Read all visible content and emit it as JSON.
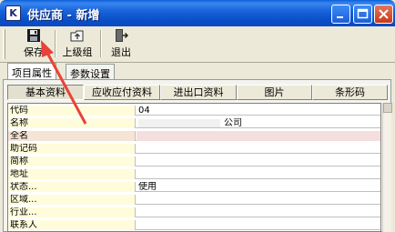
{
  "window": {
    "title": "供应商 - 新增",
    "app_icon_glyph": "K"
  },
  "toolbar": {
    "save_label": "保存",
    "up_level_label": "上级组",
    "exit_label": "退出"
  },
  "tabs": [
    {
      "label": "项目属性",
      "active": true
    },
    {
      "label": "参数设置",
      "active": false
    }
  ],
  "sub_tabs": [
    {
      "label": "基本资料",
      "active": true
    },
    {
      "label": "应收应付资料",
      "active": false
    },
    {
      "label": "进出口资料",
      "active": false
    },
    {
      "label": "图片",
      "active": false
    },
    {
      "label": "条形码",
      "active": false
    }
  ],
  "grid": {
    "rows": [
      {
        "label": "代码",
        "value": "04"
      },
      {
        "label": "名称",
        "value": "公司"
      },
      {
        "label": "全名",
        "value": ""
      },
      {
        "label": "助记码",
        "value": ""
      },
      {
        "label": "简称",
        "value": ""
      },
      {
        "label": "地址",
        "value": ""
      },
      {
        "label": "状态...",
        "value": "使用"
      },
      {
        "label": "区域...",
        "value": ""
      },
      {
        "label": "行业...",
        "value": ""
      },
      {
        "label": "联系人",
        "value": ""
      }
    ]
  },
  "colors": {
    "titlebar": "#0a4fc8",
    "annotation_arrow": "#e8423a",
    "label_column_bg": "#fffcdc",
    "highlight_row_bg": "#f5dede"
  }
}
